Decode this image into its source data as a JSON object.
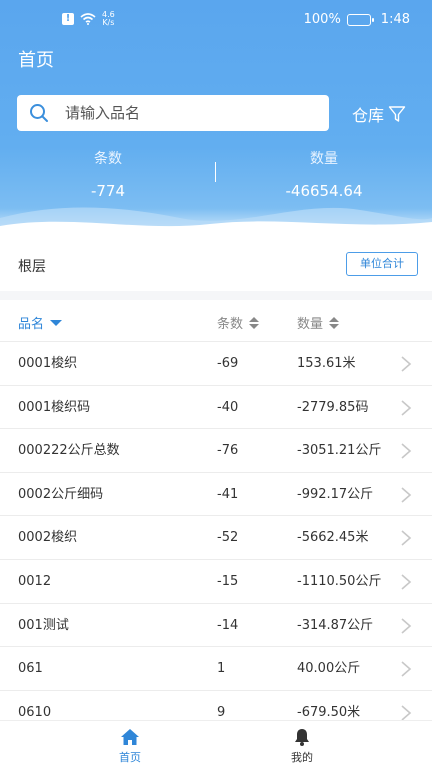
{
  "status_bar": {
    "speed_value": "4.6",
    "speed_unit": "K/s",
    "battery": "100%",
    "time": "1:48"
  },
  "header": {
    "title": "首页",
    "search_placeholder": "请输入品名",
    "warehouse_label": "仓库"
  },
  "stats": {
    "count_label": "条数",
    "count_value": "-774",
    "qty_label": "数量",
    "qty_value": "-46654.64"
  },
  "section": {
    "title": "根层",
    "unit_button": "单位合计"
  },
  "table": {
    "headers": {
      "name": "品名",
      "count": "条数",
      "qty": "数量"
    },
    "rows": [
      {
        "name": "0001梭织",
        "count": "-69",
        "qty": "153.61米"
      },
      {
        "name": "0001梭织码",
        "count": "-40",
        "qty": "-2779.85码"
      },
      {
        "name": "000222公斤总数",
        "count": "-76",
        "qty": "-3051.21公斤"
      },
      {
        "name": "0002公斤细码",
        "count": "-41",
        "qty": "-992.17公斤"
      },
      {
        "name": "0002梭织",
        "count": "-52",
        "qty": "-5662.45米"
      },
      {
        "name": "0012",
        "count": "-15",
        "qty": "-1110.50公斤"
      },
      {
        "name": "001测试",
        "count": "-14",
        "qty": "-314.87公斤"
      },
      {
        "name": "061",
        "count": "1",
        "qty": "40.00公斤"
      },
      {
        "name": "0610",
        "count": "9",
        "qty": "-679.50米"
      }
    ]
  },
  "tabbar": {
    "home": "首页",
    "me": "我的"
  },
  "colors": {
    "accent": "#2f86d8",
    "header_blue": "#5aa6ee"
  }
}
